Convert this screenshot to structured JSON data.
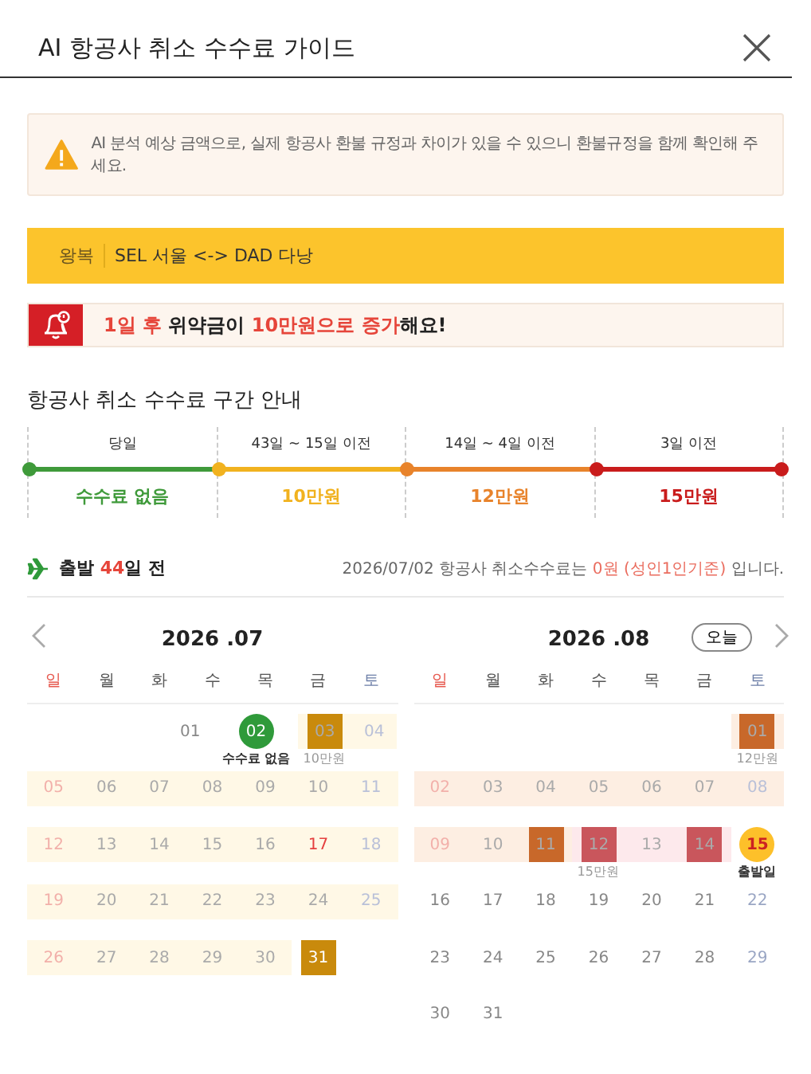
{
  "window": {
    "title": "AI 항공사 취소 수수료 가이드"
  },
  "notice": "AI 분석 예상 금액으로, 실제 항공사 환불 규정과 차이가 있을 수 있으니 환불규정을 함께 확인해 주세요.",
  "route": {
    "trip": "왕복",
    "text": "SEL 서울 <-> DAD 다낭"
  },
  "alert": {
    "parts": [
      {
        "text": "1일 후",
        "highlight": true
      },
      {
        "text": " 위약금이 ",
        "highlight": false
      },
      {
        "text": "10만원으로 증가",
        "highlight": true
      },
      {
        "text": "해요!",
        "highlight": false
      }
    ]
  },
  "section_title": "항공사 취소 수수료 구간 안내",
  "segments": [
    {
      "label": "당일",
      "fee": "수수료 없음",
      "color": "#3f9a3a"
    },
    {
      "label": "43일 ~ 15일 이전",
      "fee": "10만원",
      "color": "#f1b21f"
    },
    {
      "label": "14일 ~ 4일 이전",
      "fee": "12만원",
      "color": "#e8832b"
    },
    {
      "label": "3일 이전",
      "fee": "15만원",
      "color": "#c91c1c"
    }
  ],
  "departure": {
    "parts": [
      {
        "text": "출발 ",
        "highlight": false
      },
      {
        "text": "44",
        "highlight": true
      },
      {
        "text": "일 전",
        "highlight": false
      }
    ]
  },
  "fee_today": {
    "parts": [
      {
        "text": "2026/07/02 항공사 취소수수료는 ",
        "highlight": false
      },
      {
        "text": "0원 (성인1인기준)",
        "highlight": true
      },
      {
        "text": " 입니다.",
        "highlight": false
      }
    ]
  },
  "today_button": "오늘",
  "months": [
    {
      "title": "2026 .07",
      "weekdays": [
        {
          "label": "일",
          "sunday": true,
          "saturday": false
        },
        {
          "label": "월",
          "sunday": false,
          "saturday": false
        },
        {
          "label": "화",
          "sunday": false,
          "saturday": false
        },
        {
          "label": "수",
          "sunday": false,
          "saturday": false
        },
        {
          "label": "목",
          "sunday": false,
          "saturday": false
        },
        {
          "label": "금",
          "sunday": false,
          "saturday": false
        },
        {
          "label": "토",
          "sunday": false,
          "saturday": true
        }
      ],
      "weeks": [
        [
          {
            "kind": "blank"
          },
          {
            "kind": "blank"
          },
          {
            "kind": "blank"
          },
          {
            "day": "01",
            "kind": "plain",
            "sunday": false,
            "saturday": false,
            "holiday": false
          },
          {
            "day": "02",
            "kind": "fee-free",
            "note": "수수료 없음"
          },
          {
            "day": "03",
            "kind": "tier1",
            "color": "#fff8e6",
            "note": "10만원"
          },
          {
            "day": "04",
            "kind": "plain",
            "color": "#fff8e6",
            "sunday": false,
            "saturday": true,
            "holiday": false
          }
        ],
        [
          {
            "day": "05",
            "kind": "plain",
            "color": "#fff8e6",
            "sunday": true,
            "saturday": false,
            "holiday": false
          },
          {
            "day": "06",
            "kind": "plain",
            "color": "#fff8e6",
            "sunday": false,
            "saturday": false,
            "holiday": false
          },
          {
            "day": "07",
            "kind": "plain",
            "color": "#fff8e6",
            "sunday": false,
            "saturday": false,
            "holiday": false
          },
          {
            "day": "08",
            "kind": "plain",
            "color": "#fff8e6",
            "sunday": false,
            "saturday": false,
            "holiday": false
          },
          {
            "day": "09",
            "kind": "plain",
            "color": "#fff8e6",
            "sunday": false,
            "saturday": false,
            "holiday": false
          },
          {
            "day": "10",
            "kind": "plain",
            "color": "#fff8e6",
            "sunday": false,
            "saturday": false,
            "holiday": false
          },
          {
            "day": "11",
            "kind": "plain",
            "color": "#fff8e6",
            "sunday": false,
            "saturday": true,
            "holiday": false
          }
        ],
        [
          {
            "day": "12",
            "kind": "plain",
            "color": "#fff8e6",
            "sunday": true,
            "saturday": false,
            "holiday": false
          },
          {
            "day": "13",
            "kind": "plain",
            "color": "#fff8e6",
            "sunday": false,
            "saturday": false,
            "holiday": false
          },
          {
            "day": "14",
            "kind": "plain",
            "color": "#fff8e6",
            "sunday": false,
            "saturday": false,
            "holiday": false
          },
          {
            "day": "15",
            "kind": "plain",
            "color": "#fff8e6",
            "sunday": false,
            "saturday": false,
            "holiday": false
          },
          {
            "day": "16",
            "kind": "plain",
            "color": "#fff8e6",
            "sunday": false,
            "saturday": false,
            "holiday": false
          },
          {
            "day": "17",
            "kind": "plain",
            "color": "#fff8e6",
            "sunday": false,
            "saturday": false,
            "holiday": true
          },
          {
            "day": "18",
            "kind": "plain",
            "color": "#fff8e6",
            "sunday": false,
            "saturday": true,
            "holiday": false
          }
        ],
        [
          {
            "day": "19",
            "kind": "plain",
            "color": "#fff8e6",
            "sunday": true,
            "saturday": false,
            "holiday": false
          },
          {
            "day": "20",
            "kind": "plain",
            "color": "#fff8e6",
            "sunday": false,
            "saturday": false,
            "holiday": false
          },
          {
            "day": "21",
            "kind": "plain",
            "color": "#fff8e6",
            "sunday": false,
            "saturday": false,
            "holiday": false
          },
          {
            "day": "22",
            "kind": "plain",
            "color": "#fff8e6",
            "sunday": false,
            "saturday": false,
            "holiday": false
          },
          {
            "day": "23",
            "kind": "plain",
            "color": "#fff8e6",
            "sunday": false,
            "saturday": false,
            "holiday": false
          },
          {
            "day": "24",
            "kind": "plain",
            "color": "#fff8e6",
            "sunday": false,
            "saturday": false,
            "holiday": false
          },
          {
            "day": "25",
            "kind": "plain",
            "color": "#fff8e6",
            "sunday": false,
            "saturday": true,
            "holiday": false
          }
        ],
        [
          {
            "day": "26",
            "kind": "plain",
            "color": "#fff8e6",
            "sunday": true,
            "saturday": false,
            "holiday": false
          },
          {
            "day": "27",
            "kind": "plain",
            "color": "#fff8e6",
            "sunday": false,
            "saturday": false,
            "holiday": false
          },
          {
            "day": "28",
            "kind": "plain",
            "color": "#fff8e6",
            "sunday": false,
            "saturday": false,
            "holiday": false
          },
          {
            "day": "29",
            "kind": "plain",
            "color": "#fff8e6",
            "sunday": false,
            "saturday": false,
            "holiday": false
          },
          {
            "day": "30",
            "kind": "plain",
            "color": "#fff8e6",
            "sunday": false,
            "saturday": false,
            "holiday": false
          },
          {
            "day": "31",
            "kind": "tier1"
          },
          {
            "kind": "blank"
          }
        ]
      ]
    },
    {
      "title": "2026 .08",
      "weekdays": [
        {
          "label": "일",
          "sunday": true,
          "saturday": false
        },
        {
          "label": "월",
          "sunday": false,
          "saturday": false
        },
        {
          "label": "화",
          "sunday": false,
          "saturday": false
        },
        {
          "label": "수",
          "sunday": false,
          "saturday": false
        },
        {
          "label": "목",
          "sunday": false,
          "saturday": false
        },
        {
          "label": "금",
          "sunday": false,
          "saturday": false
        },
        {
          "label": "토",
          "sunday": false,
          "saturday": true
        }
      ],
      "weeks": [
        [
          {
            "kind": "blank"
          },
          {
            "kind": "blank"
          },
          {
            "kind": "blank"
          },
          {
            "kind": "blank"
          },
          {
            "kind": "blank"
          },
          {
            "kind": "blank"
          },
          {
            "day": "01",
            "kind": "tier2",
            "color": "#fdeee2",
            "note": "12만원"
          }
        ],
        [
          {
            "day": "02",
            "kind": "plain",
            "color": "#fdeee2",
            "sunday": true,
            "saturday": false,
            "holiday": false
          },
          {
            "day": "03",
            "kind": "plain",
            "color": "#fdeee2",
            "sunday": false,
            "saturday": false,
            "holiday": false
          },
          {
            "day": "04",
            "kind": "plain",
            "color": "#fdeee2",
            "sunday": false,
            "saturday": false,
            "holiday": false
          },
          {
            "day": "05",
            "kind": "plain",
            "color": "#fdeee2",
            "sunday": false,
            "saturday": false,
            "holiday": false
          },
          {
            "day": "06",
            "kind": "plain",
            "color": "#fdeee2",
            "sunday": false,
            "saturday": false,
            "holiday": false
          },
          {
            "day": "07",
            "kind": "plain",
            "color": "#fdeee2",
            "sunday": false,
            "saturday": false,
            "holiday": false
          },
          {
            "day": "08",
            "kind": "plain",
            "color": "#fdeee2",
            "sunday": false,
            "saturday": true,
            "holiday": false
          }
        ],
        [
          {
            "day": "09",
            "kind": "plain",
            "color": "#fdeee2",
            "sunday": true,
            "saturday": false,
            "holiday": false
          },
          {
            "day": "10",
            "kind": "plain",
            "color": "#fdeee2",
            "sunday": false,
            "saturday": false,
            "holiday": false
          },
          {
            "day": "11",
            "kind": "tier2",
            "color": "#fdeee2"
          },
          {
            "day": "12",
            "kind": "tier3",
            "color": "#fde9ec",
            "note": "15만원"
          },
          {
            "day": "13",
            "kind": "plain",
            "color": "#fde9ec",
            "sunday": false,
            "saturday": false,
            "holiday": false
          },
          {
            "day": "14",
            "kind": "tier3",
            "color": "#fde9ec"
          },
          {
            "day": "15",
            "kind": "depart",
            "note": "출발일"
          }
        ],
        [
          {
            "day": "16",
            "kind": "plain",
            "sunday": false,
            "saturday": false,
            "holiday": false
          },
          {
            "day": "17",
            "kind": "plain",
            "sunday": false,
            "saturday": false,
            "holiday": false
          },
          {
            "day": "18",
            "kind": "plain",
            "sunday": false,
            "saturday": false,
            "holiday": false
          },
          {
            "day": "19",
            "kind": "plain",
            "sunday": false,
            "saturday": false,
            "holiday": false
          },
          {
            "day": "20",
            "kind": "plain",
            "sunday": false,
            "saturday": false,
            "holiday": false
          },
          {
            "day": "21",
            "kind": "plain",
            "sunday": false,
            "saturday": false,
            "holiday": false
          },
          {
            "day": "22",
            "kind": "plain",
            "sunday": false,
            "saturday": true,
            "holiday": false
          }
        ],
        [
          {
            "day": "23",
            "kind": "plain",
            "sunday": false,
            "saturday": false,
            "holiday": false
          },
          {
            "day": "24",
            "kind": "plain",
            "sunday": false,
            "saturday": false,
            "holiday": false
          },
          {
            "day": "25",
            "kind": "plain",
            "sunday": false,
            "saturday": false,
            "holiday": false
          },
          {
            "day": "26",
            "kind": "plain",
            "sunday": false,
            "saturday": false,
            "holiday": false
          },
          {
            "day": "27",
            "kind": "plain",
            "sunday": false,
            "saturday": false,
            "holiday": false
          },
          {
            "day": "28",
            "kind": "plain",
            "sunday": false,
            "saturday": false,
            "holiday": false
          },
          {
            "day": "29",
            "kind": "plain",
            "sunday": false,
            "saturday": true,
            "holiday": false
          }
        ],
        [
          {
            "day": "30",
            "kind": "plain",
            "sunday": false,
            "saturday": false,
            "holiday": false
          },
          {
            "day": "31",
            "kind": "plain",
            "sunday": false,
            "saturday": false,
            "holiday": false
          },
          {
            "kind": "blank"
          },
          {
            "kind": "blank"
          },
          {
            "kind": "blank"
          },
          {
            "kind": "blank"
          },
          {
            "kind": "blank"
          }
        ]
      ]
    }
  ]
}
